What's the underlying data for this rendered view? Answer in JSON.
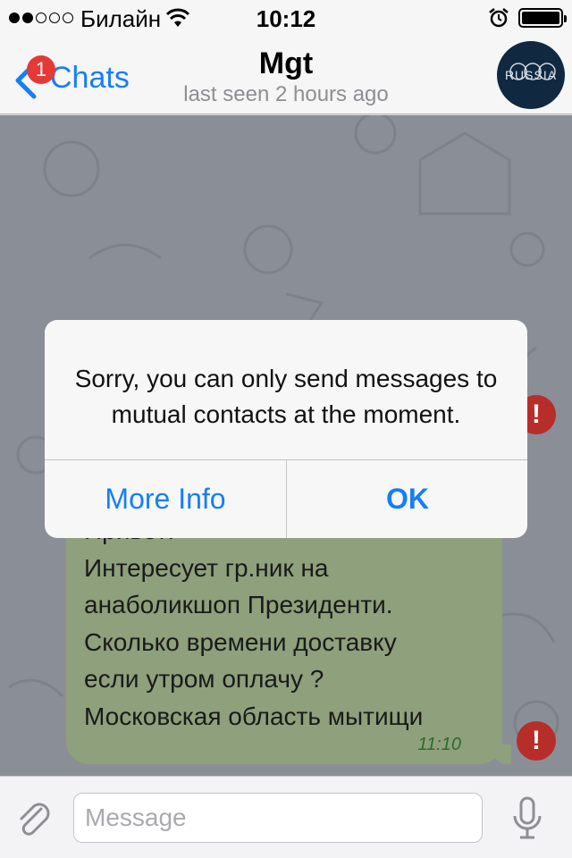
{
  "status_bar": {
    "carrier": "Билайн",
    "time": "10:12",
    "battery_level": 1.0,
    "icons": [
      "signal-dots",
      "wifi-icon",
      "alarm-icon",
      "battery-icon"
    ]
  },
  "nav": {
    "back_label": "Chats",
    "unread_count": "1",
    "title": "Mgt",
    "subtitle": "last seen 2 hours ago",
    "avatar_text": "RUSSIA"
  },
  "chat": {
    "message_text": "Привет!\nИнтересует гр.ник на\nанаболикшоп Президенти.\nСколько времени доставку\nесли утром оплачу ?\nМосковская область мытищи",
    "message_time": "11:10",
    "error_glyph": "!"
  },
  "alert": {
    "message": "Sorry, you can only send messages to mutual contacts at the moment.",
    "more_info_label": "More Info",
    "ok_label": "OK"
  },
  "input": {
    "placeholder": "Message",
    "value": ""
  },
  "colors": {
    "accent": "#157efb",
    "bubble": "#8ea07c",
    "error": "#b72d2a",
    "badge": "#e53935"
  }
}
